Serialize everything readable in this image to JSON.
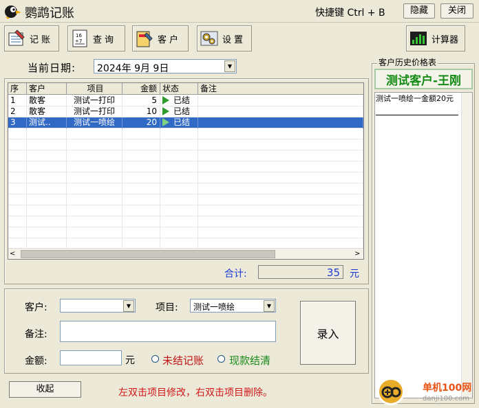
{
  "window": {
    "title": "鹦鹉记账",
    "hotkey_text": "快捷键 Ctrl + B",
    "hide_label": "隐藏",
    "close_label": "关闭"
  },
  "toolbar": {
    "record_label": "记账",
    "query_label": "查询",
    "customer_label": "客户",
    "settings_label": "设置",
    "calculator_label": "计算器"
  },
  "date": {
    "label": "当前日期:",
    "value": "2024年 9月 9日"
  },
  "grid": {
    "columns": [
      "序",
      "客户",
      "项目",
      "金额",
      "状态",
      "备注"
    ],
    "rows": [
      {
        "no": "1",
        "customer": "散客",
        "item": "测试一打印",
        "amount": "5",
        "status": "已结",
        "note": "",
        "selected": false
      },
      {
        "no": "2",
        "customer": "散客",
        "item": "测试一打印",
        "amount": "10",
        "status": "已结",
        "note": "",
        "selected": false
      },
      {
        "no": "3",
        "customer": "测试..",
        "item": "测试一喷绘",
        "amount": "20",
        "status": "已结",
        "note": "",
        "selected": true
      }
    ]
  },
  "total": {
    "label": "合计:",
    "value": "35",
    "unit": "元"
  },
  "entry": {
    "customer_label": "客户:",
    "customer_value": "",
    "item_label": "项目:",
    "item_value": "测试一喷绘",
    "note_label": "备注:",
    "note_value": "",
    "amount_label": "金额:",
    "amount_value": "",
    "amount_unit": "元",
    "unsettled_label": "未结记账",
    "cash_label": "现款结清",
    "submit_label": "录入"
  },
  "footer": {
    "collapse_label": "收起",
    "hint": "左双击项目修改，右双击项目删除。"
  },
  "history": {
    "title": "客户历史价格表",
    "customer_name": "测试客户-王刚",
    "entries": [
      "测试一喷绘一金额20元"
    ]
  },
  "watermark": {
    "text1": "单机100网",
    "text2": "danji100.com"
  }
}
